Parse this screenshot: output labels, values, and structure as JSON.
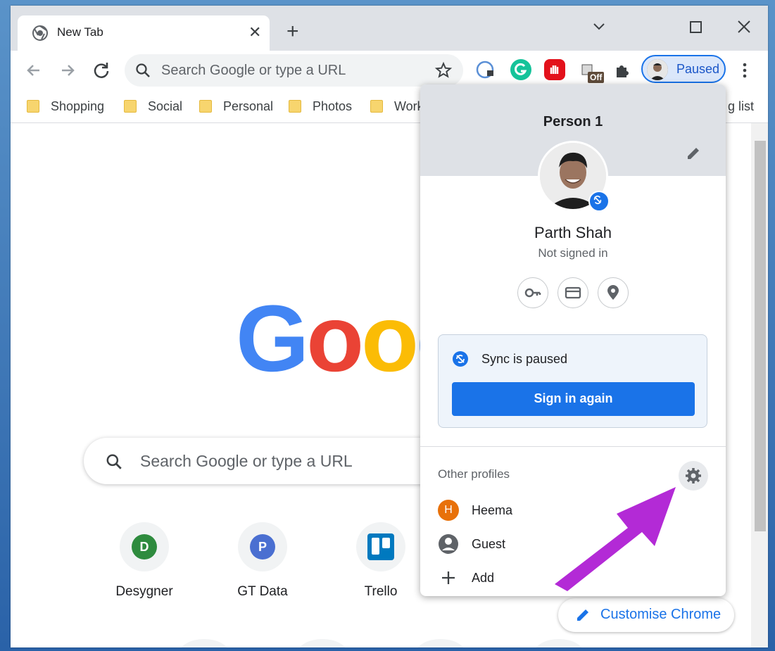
{
  "tab": {
    "title": "New Tab"
  },
  "omnibox": {
    "placeholder": "Search Google or type a URL"
  },
  "profile_chip": {
    "label": "Paused"
  },
  "extensions": {
    "coffee_badge": "Off"
  },
  "bookmarks": {
    "items": [
      {
        "label": "Shopping"
      },
      {
        "label": "Social"
      },
      {
        "label": "Personal"
      },
      {
        "label": "Photos"
      },
      {
        "label": "Work"
      }
    ],
    "overflow_tail": "g list"
  },
  "ntp": {
    "search_placeholder": "Search Google or type a URL",
    "shortcuts": [
      {
        "label": "Desygner",
        "badge": "D",
        "color": "#2e8b3e"
      },
      {
        "label": "GT Data",
        "badge": "P",
        "color": "#4a6fd1"
      },
      {
        "label": "Trello",
        "badge": "",
        "color": "#0079bf"
      }
    ],
    "customise_label": "Customise Chrome"
  },
  "panel": {
    "title": "Person 1",
    "name": "Parth Shah",
    "status": "Not signed in",
    "sync_text": "Sync is paused",
    "signin_label": "Sign in again",
    "other_title": "Other profiles",
    "profiles": [
      {
        "label": "Heema",
        "initial": "H",
        "color": "#e8710a"
      },
      {
        "label": "Guest",
        "initial": "",
        "color": "#5f6368"
      },
      {
        "label": "Add",
        "initial": "",
        "color": ""
      }
    ]
  },
  "colors": {
    "accent": "#1a73e8",
    "arrow": "#b32ad6"
  }
}
